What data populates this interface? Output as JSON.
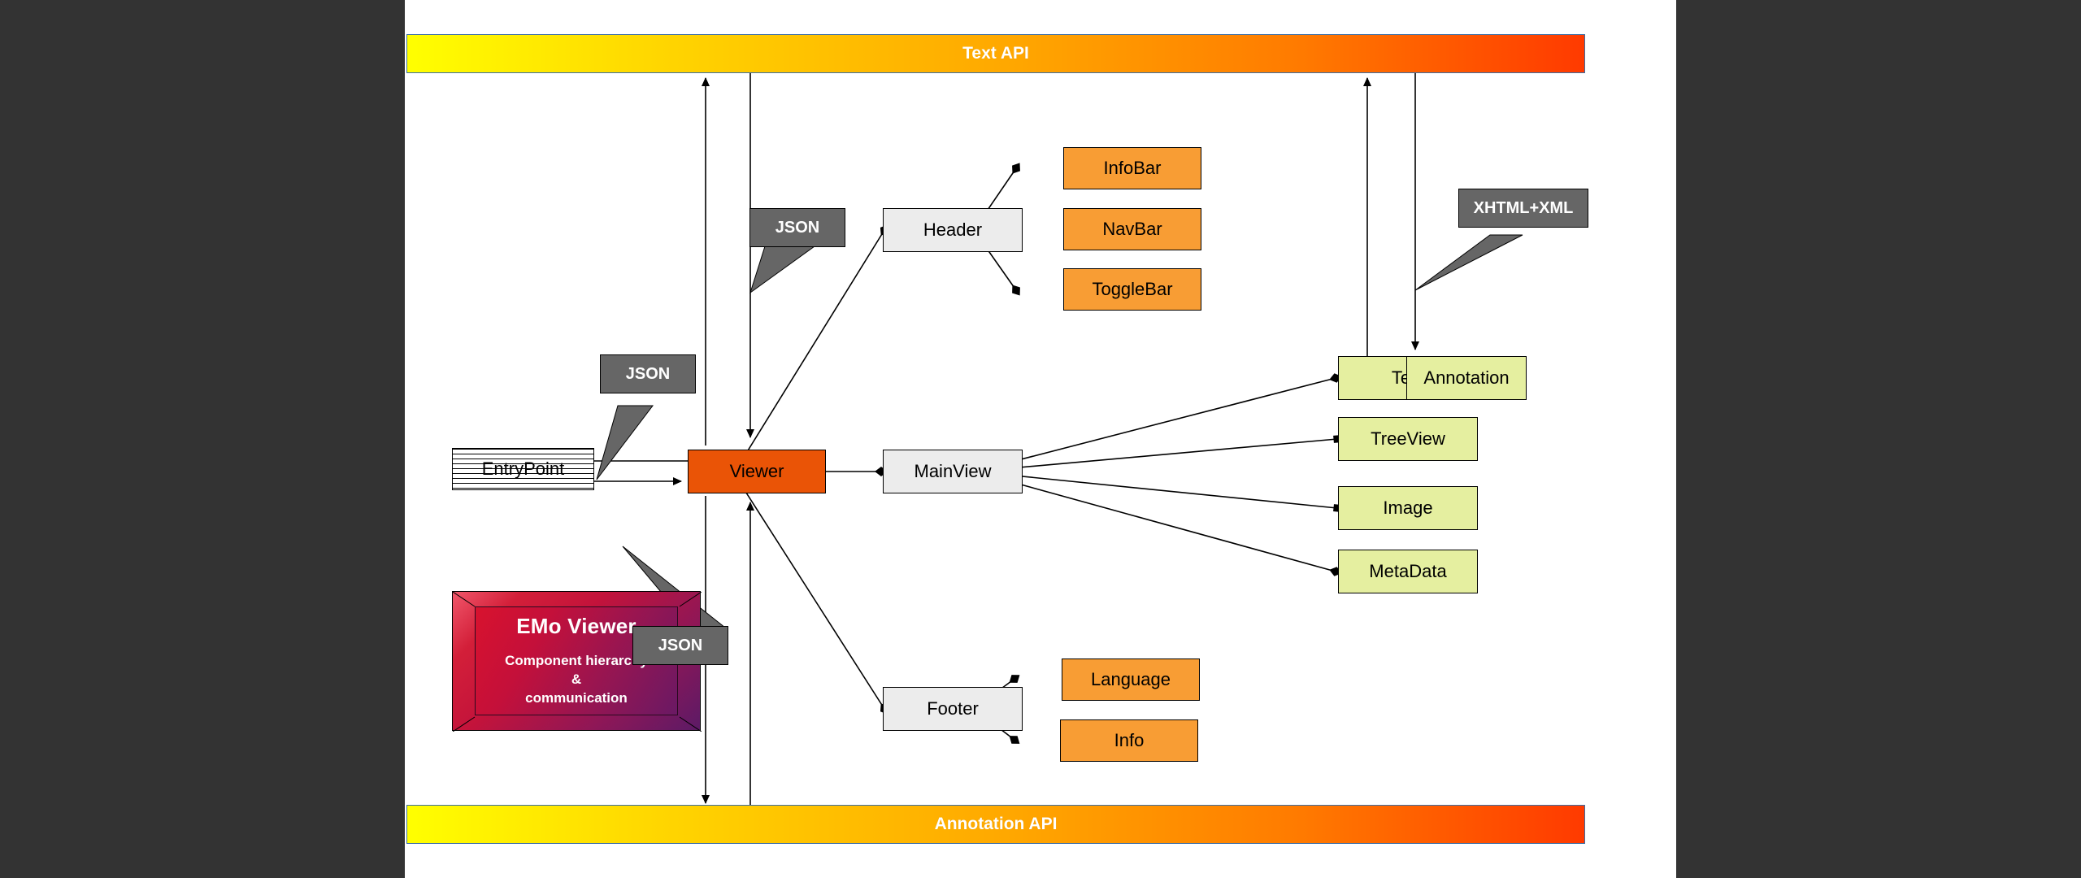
{
  "page": {
    "background_color": "#333333",
    "canvas_color": "#ffffff",
    "title": "EMo Viewer component hierarchy and communication diagram"
  },
  "colors": {
    "api_bar_gradient_start": "#ffff00",
    "api_bar_gradient_end": "#ff3a00",
    "api_bar_border": "#3b6ea5",
    "container_gray": "#ececec",
    "leaf_orange": "#f89d34",
    "leaf_green": "#e5efa0",
    "viewer_orange": "#ea5406",
    "callout_gray": "#666666",
    "legend_red": "#d31f39",
    "legend_purple": "#5c1a66",
    "edge_color": "#000000"
  },
  "api_bars": {
    "top": {
      "label": "Text API"
    },
    "bottom": {
      "label": "Annotation API"
    }
  },
  "nodes": [
    {
      "id": "entrypoint",
      "label": "EntryPoint",
      "kind": "striped"
    },
    {
      "id": "viewer",
      "label": "Viewer",
      "kind": "viewer"
    },
    {
      "id": "header",
      "label": "Header",
      "kind": "gray"
    },
    {
      "id": "mainview",
      "label": "MainView",
      "kind": "gray"
    },
    {
      "id": "footer",
      "label": "Footer",
      "kind": "gray"
    },
    {
      "id": "infobar",
      "label": "InfoBar",
      "kind": "orange"
    },
    {
      "id": "navbar",
      "label": "NavBar",
      "kind": "orange"
    },
    {
      "id": "togglebar",
      "label": "ToggleBar",
      "kind": "orange"
    },
    {
      "id": "language",
      "label": "Language",
      "kind": "orange"
    },
    {
      "id": "info",
      "label": "Info",
      "kind": "orange"
    },
    {
      "id": "text",
      "label": "Text",
      "kind": "green"
    },
    {
      "id": "annotation",
      "label": "Annotation",
      "kind": "green"
    },
    {
      "id": "treeview",
      "label": "TreeView",
      "kind": "green"
    },
    {
      "id": "image",
      "label": "Image",
      "kind": "green"
    },
    {
      "id": "metadata",
      "label": "MetaData",
      "kind": "green"
    }
  ],
  "callouts": [
    {
      "id": "callout-json-top",
      "label": "JSON"
    },
    {
      "id": "callout-json-left",
      "label": "JSON"
    },
    {
      "id": "callout-json-bottom",
      "label": "JSON"
    },
    {
      "id": "callout-xhtml-xml",
      "label": "XHTML+XML"
    }
  ],
  "legend": {
    "title": "EMo Viewer",
    "subtitle_line1": "Component hierarchy",
    "subtitle_line2": "&",
    "subtitle_line3": "communication"
  }
}
